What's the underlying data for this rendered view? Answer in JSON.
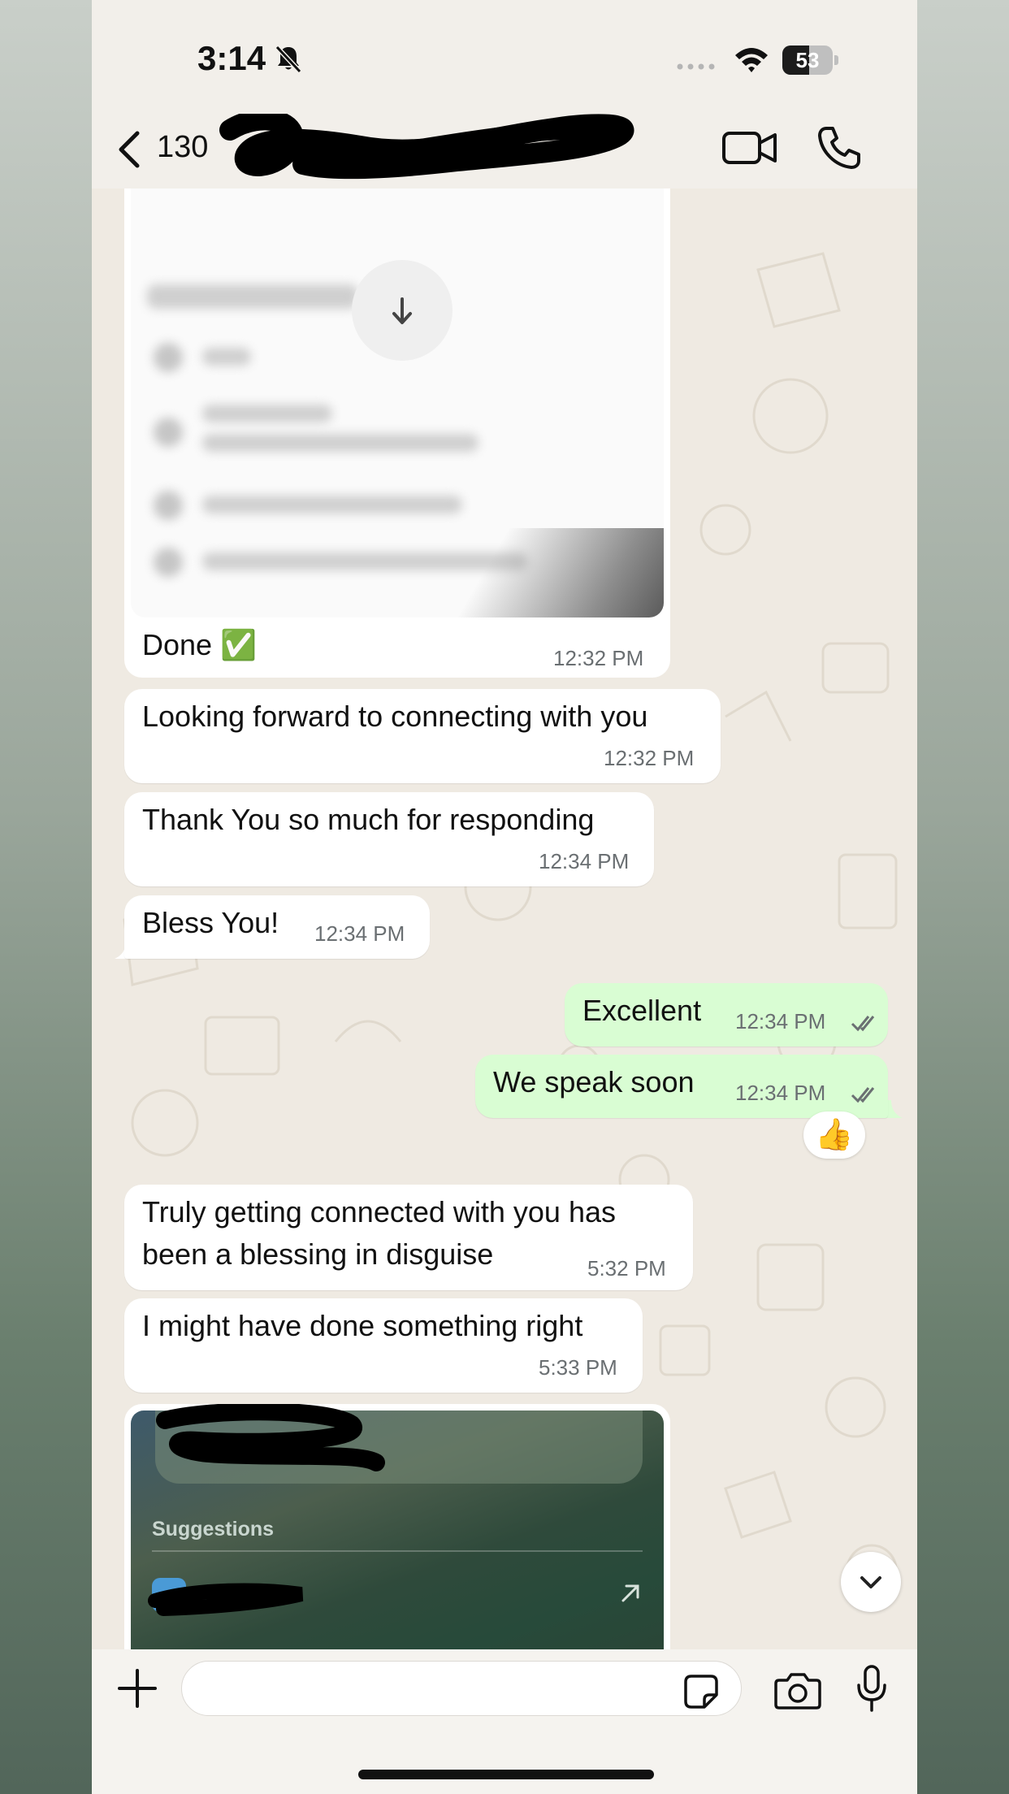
{
  "status_bar": {
    "time": "3:14",
    "battery": "53"
  },
  "header": {
    "contact_visible": "130"
  },
  "messages": [
    {
      "id": "m1",
      "text": "Done ✅",
      "time": "12:32 PM"
    },
    {
      "id": "m2",
      "text": "Looking forward to connecting with you",
      "time": "12:32 PM"
    },
    {
      "id": "m3",
      "text": "Thank You so much for responding",
      "time": "12:34 PM"
    },
    {
      "id": "m4",
      "text": "Bless You!",
      "time": "12:34 PM"
    },
    {
      "id": "m5",
      "text": "Excellent",
      "time": "12:34 PM"
    },
    {
      "id": "m6",
      "text": "We speak soon",
      "time": "12:34 PM",
      "reaction": "👍"
    },
    {
      "id": "m7",
      "text_line1": "Truly getting connected with you has",
      "text_line2": "been a blessing in disguise",
      "time": "5:32 PM"
    },
    {
      "id": "m8",
      "text": "I might have done something right",
      "time": "5:33 PM"
    }
  ],
  "screenshot_preview": {
    "suggestions_label": "Suggestions"
  },
  "colors": {
    "incoming_bubble": "#ffffff",
    "outgoing_bubble": "#d9fdd3",
    "chat_bg": "#efeae2",
    "read_ticks": "#6a6f72"
  }
}
